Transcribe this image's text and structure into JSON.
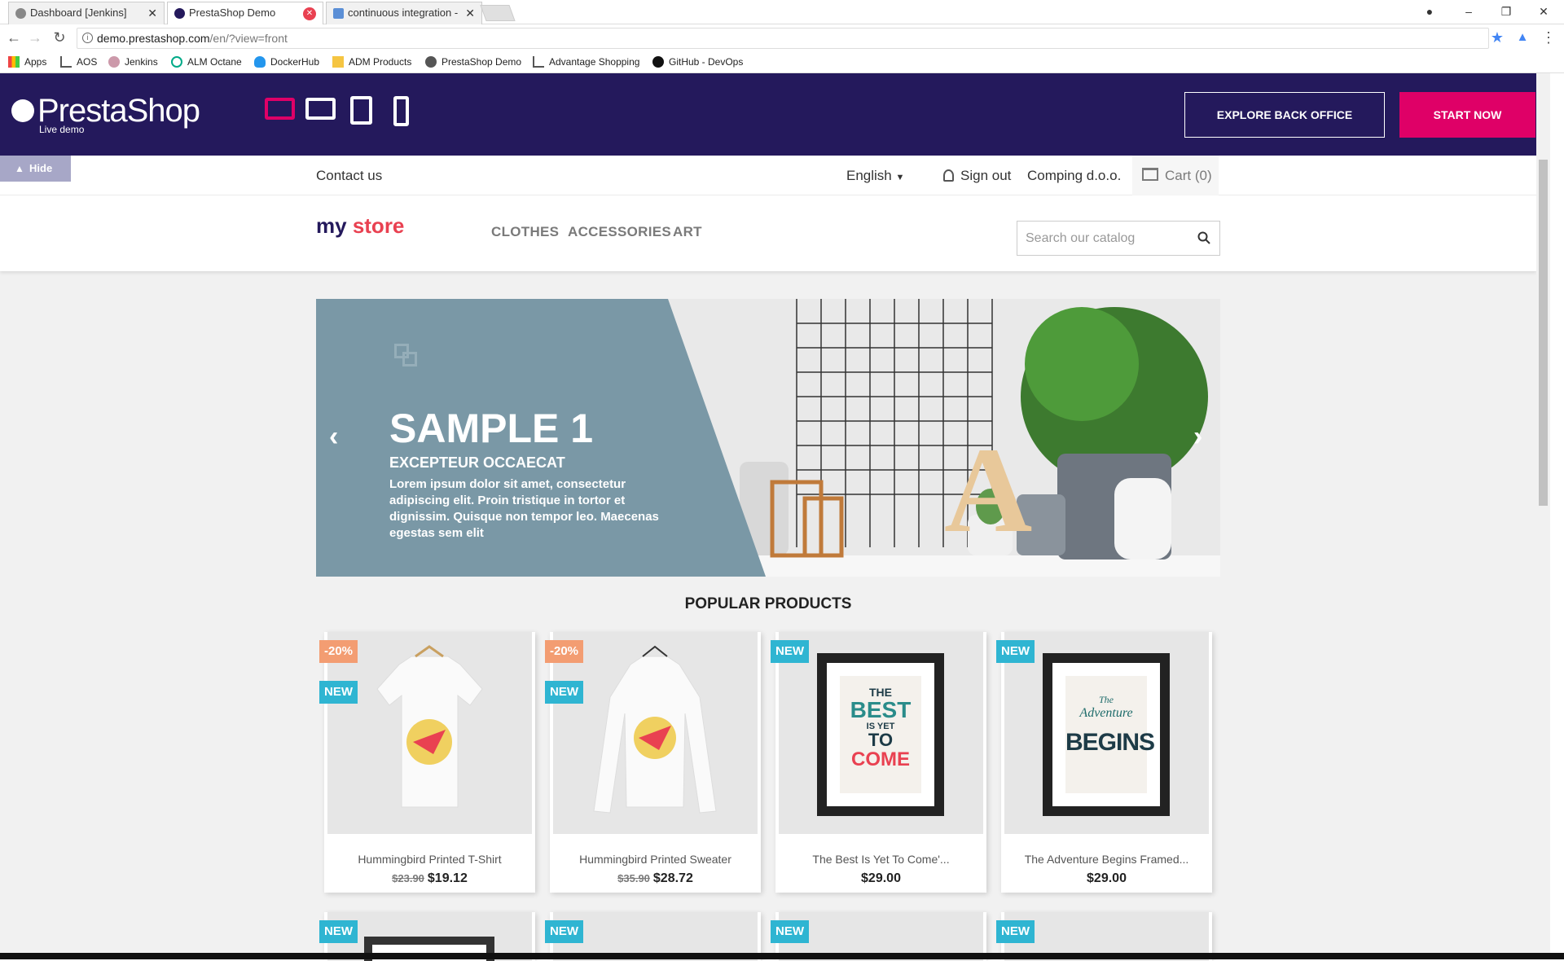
{
  "browser": {
    "tabs": [
      {
        "title": "Dashboard [Jenkins]"
      },
      {
        "title": "PrestaShop Demo"
      },
      {
        "title": "continuous integration -"
      }
    ],
    "url_host": "demo.prestashop.com",
    "url_path": "/en/?view=front",
    "bookmarks": [
      "Apps",
      "AOS",
      "Jenkins",
      "ALM Octane",
      "DockerHub",
      "ADM Products",
      "PrestaShop Demo",
      "Advantage Shopping",
      "GitHub - DevOps"
    ]
  },
  "demo_header": {
    "logo_name": "PrestaShop",
    "logo_sub": "Live demo",
    "explore_label": "EXPLORE BACK OFFICE",
    "start_label": "START NOW",
    "accent": "#df0067",
    "background": "#24195c"
  },
  "topnav": {
    "hide_label": "Hide",
    "contact": "Contact us",
    "language": "English",
    "signout": "Sign out",
    "company": "Comping d.o.o.",
    "cart": "Cart (0)"
  },
  "mainnav": {
    "logo_my": "my",
    "logo_store": "store",
    "categories": [
      "CLOTHES",
      "ACCESSORIES",
      "ART"
    ],
    "search_placeholder": "Search our catalog"
  },
  "slider": {
    "title": "SAMPLE 1",
    "subtitle": "EXCEPTEUR OCCAECAT",
    "text": "Lorem ipsum dolor sit amet, consectetur adipiscing elit. Proin tristique in tortor et dignissim. Quisque non tempor leo. Maecenas egestas sem elit",
    "photo_letter": "A"
  },
  "popular": {
    "title": "POPULAR PRODUCTS",
    "products": [
      {
        "name": "Hummingbird Printed T-Shirt",
        "old_price": "$23.90",
        "price": "$19.12",
        "discount": "-20%",
        "flag": "NEW"
      },
      {
        "name": "Hummingbird Printed Sweater",
        "old_price": "$35.90",
        "price": "$28.72",
        "discount": "-20%",
        "flag": "NEW"
      },
      {
        "name": "The Best Is Yet To Come'...",
        "price": "$29.00",
        "flag": "NEW"
      },
      {
        "name": "The Adventure Begins Framed...",
        "price": "$29.00",
        "flag": "NEW"
      }
    ],
    "row2_flags": [
      "NEW",
      "NEW",
      "NEW",
      "NEW"
    ]
  },
  "posters": {
    "best_the": "THE",
    "best_best": "BEST",
    "best_isyet": "IS YET",
    "best_to": "TO",
    "best_come": "COME",
    "adv_the": "The",
    "adv_adventure": "Adventure",
    "adv_begins": "BEGINS"
  }
}
